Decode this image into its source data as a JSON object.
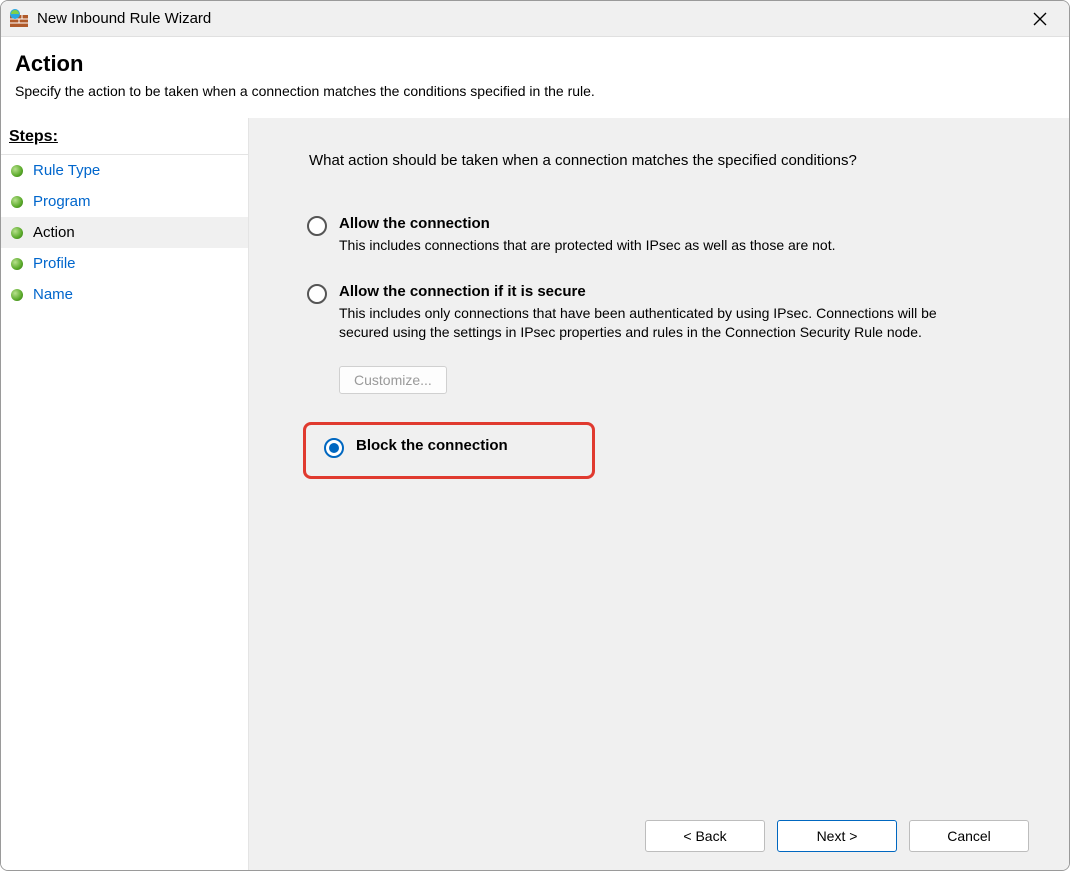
{
  "window": {
    "title": "New Inbound Rule Wizard"
  },
  "header": {
    "title": "Action",
    "subtitle": "Specify the action to be taken when a connection matches the conditions specified in the rule."
  },
  "sidebar": {
    "heading": "Steps:",
    "items": [
      {
        "label": "Rule Type",
        "current": false
      },
      {
        "label": "Program",
        "current": false
      },
      {
        "label": "Action",
        "current": true
      },
      {
        "label": "Profile",
        "current": false
      },
      {
        "label": "Name",
        "current": false
      }
    ]
  },
  "content": {
    "prompt": "What action should be taken when a connection matches the specified conditions?",
    "options": [
      {
        "id": "allow",
        "title": "Allow the connection",
        "desc": "This includes connections that are protected with IPsec as well as those are not.",
        "checked": false
      },
      {
        "id": "allow-secure",
        "title": "Allow the connection if it is secure",
        "desc": "This includes only connections that have been authenticated by using IPsec. Connections will be secured using the settings in IPsec properties and rules in the Connection Security Rule node.",
        "checked": false,
        "customize_label": "Customize..."
      },
      {
        "id": "block",
        "title": "Block the connection",
        "desc": "",
        "checked": true
      }
    ]
  },
  "footer": {
    "back": "< Back",
    "next": "Next >",
    "cancel": "Cancel"
  }
}
